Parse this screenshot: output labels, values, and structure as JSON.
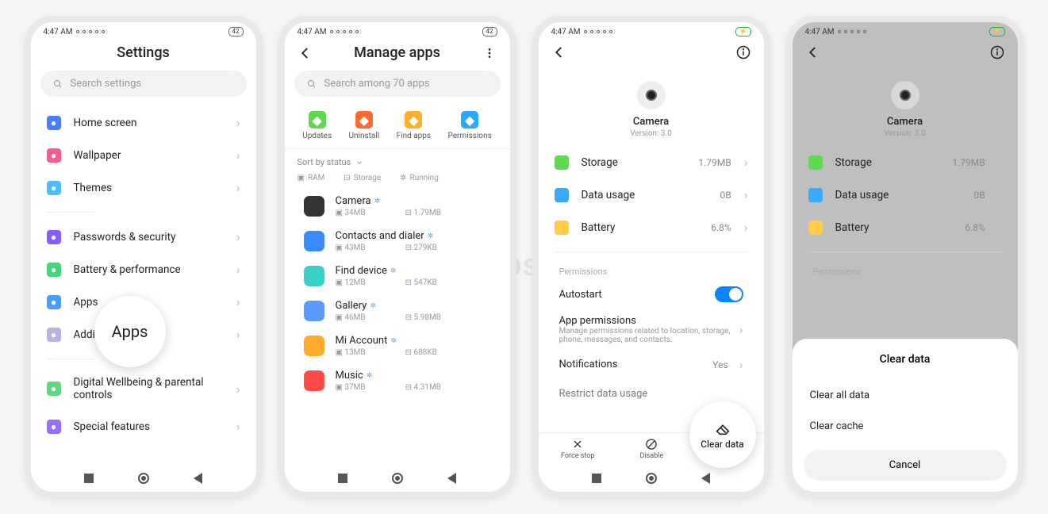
{
  "status": {
    "time": "4:47 AM",
    "battery": "42"
  },
  "screen1": {
    "title": "Settings",
    "search_placeholder": "Search settings",
    "items": [
      {
        "label": "Home screen",
        "color": "#4a7cff",
        "icon": "home"
      },
      {
        "label": "Wallpaper",
        "color": "#ff5a8e",
        "icon": "wallpaper"
      },
      {
        "label": "Themes",
        "color": "#4dbdff",
        "icon": "themes"
      }
    ],
    "items2": [
      {
        "label": "Passwords & security",
        "color": "#8a5cff",
        "icon": "shield"
      },
      {
        "label": "Battery & performance",
        "color": "#3ed97f",
        "icon": "battery"
      },
      {
        "label": "Apps",
        "color": "#4a9dff",
        "icon": "apps"
      },
      {
        "label": "Additional settings",
        "color": "#b5b5e0",
        "icon": "more"
      }
    ],
    "items3": [
      {
        "label": "Digital Wellbeing & parental controls",
        "color": "#5fd97f",
        "icon": "wellbeing"
      },
      {
        "label": "Special features",
        "color": "#9a6cff",
        "icon": "special"
      }
    ],
    "magnifier": "Apps"
  },
  "screen2": {
    "title": "Manage apps",
    "search_placeholder": "Search among 70 apps",
    "actions": [
      {
        "label": "Updates",
        "color": "#5fd94f"
      },
      {
        "label": "Uninstall",
        "color": "#ff6a2a"
      },
      {
        "label": "Find apps",
        "color": "#ffb02a"
      },
      {
        "label": "Permissions",
        "color": "#2aaaff"
      }
    ],
    "sort": "Sort by status",
    "meta": [
      "RAM",
      "Storage",
      "Running"
    ],
    "apps": [
      {
        "name": "Camera",
        "ram": "34MB",
        "storage": "1.79MB",
        "color": "#333"
      },
      {
        "name": "Contacts and dialer",
        "ram": "43MB",
        "storage": "279KB",
        "color": "#3a8aff"
      },
      {
        "name": "Find device",
        "ram": "12MB",
        "storage": "547KB",
        "color": "#3ad0c8"
      },
      {
        "name": "Gallery",
        "ram": "46MB",
        "storage": "5.98MB",
        "color": "#5a9aff"
      },
      {
        "name": "Mi Account",
        "ram": "13MB",
        "storage": "688KB",
        "color": "#ffaa2a"
      },
      {
        "name": "Music",
        "ram": "37MB",
        "storage": "4.31MB",
        "color": "#ff4a4a"
      }
    ]
  },
  "screen3": {
    "app_name": "Camera",
    "version": "Version: 3.0",
    "stats": [
      {
        "label": "Storage",
        "value": "1.79MB",
        "color": "#5fd94f"
      },
      {
        "label": "Data usage",
        "value": "0B",
        "color": "#3aaaff"
      },
      {
        "label": "Battery",
        "value": "6.8%",
        "color": "#ffcc4a"
      }
    ],
    "permissions_label": "Permissions",
    "autostart": "Autostart",
    "app_perm_title": "App permissions",
    "app_perm_sub": "Manage permissions related to location, storage, phone, messages, and contacts.",
    "notifications": "Notifications",
    "notifications_value": "Yes",
    "restrict": "Restrict data usage",
    "bottom": [
      {
        "label": "Force stop",
        "icon": "x"
      },
      {
        "label": "Disable",
        "icon": "slash"
      },
      {
        "label": "Clear data",
        "icon": "erase"
      }
    ],
    "magnifier": "Clear data"
  },
  "screen4": {
    "dialog_title": "Clear data",
    "opt1": "Clear all data",
    "opt2": "Clear cache",
    "cancel": "Cancel"
  },
  "watermark": "www.getdroidtips.com"
}
